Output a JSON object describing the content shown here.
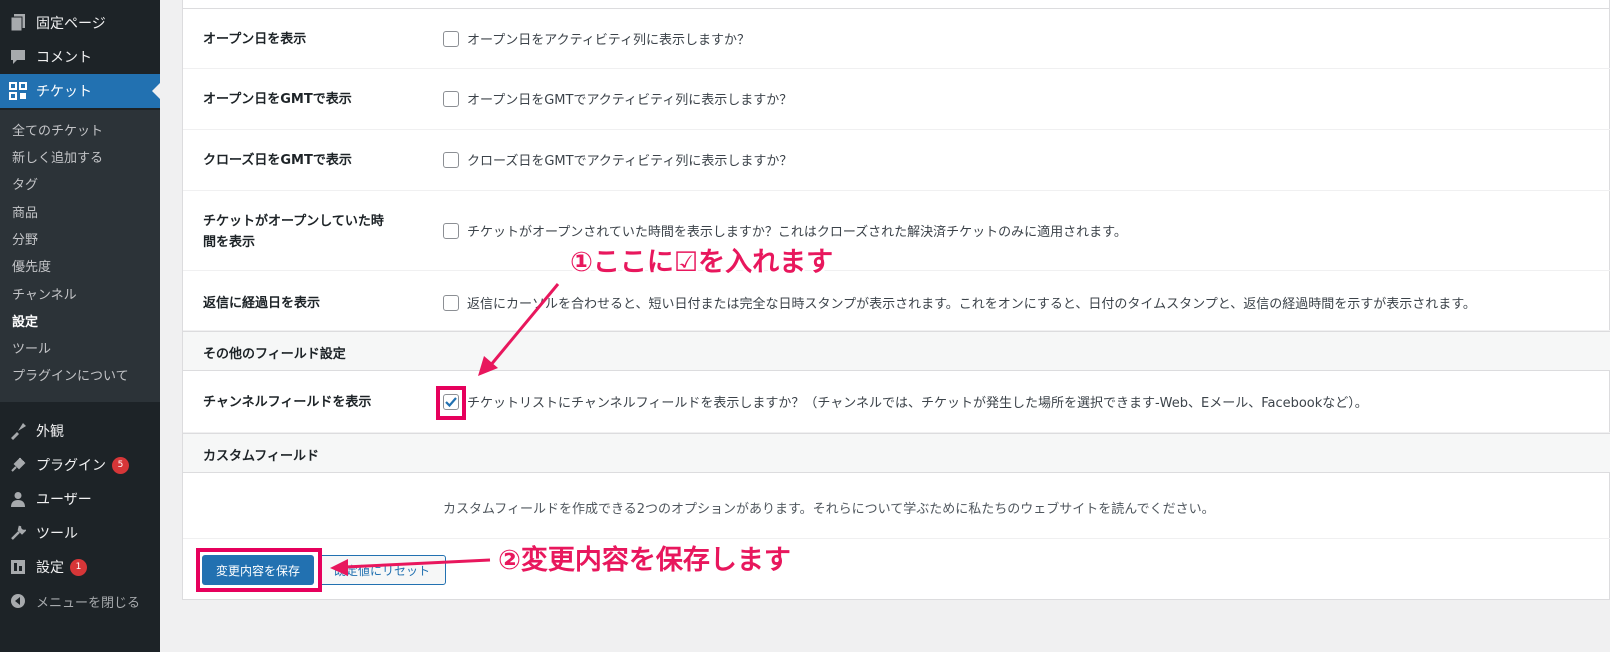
{
  "sidebar": {
    "menu": [
      {
        "label": "固定ページ",
        "icon": "pages-icon"
      },
      {
        "label": "コメント",
        "icon": "comment-icon"
      },
      {
        "label": "チケット",
        "icon": "ticket-icon"
      }
    ],
    "submenu": [
      "全てのチケット",
      "新しく追加する",
      "タグ",
      "商品",
      "分野",
      "優先度",
      "チャンネル",
      "設定",
      "ツール",
      "プラグインについて"
    ],
    "menu2": [
      {
        "label": "外観",
        "icon": "appearance-icon"
      },
      {
        "label": "プラグイン",
        "icon": "plugin-icon",
        "badge": "5"
      },
      {
        "label": "ユーザー",
        "icon": "user-icon"
      },
      {
        "label": "ツール",
        "icon": "wrench-icon"
      },
      {
        "label": "設定",
        "icon": "settings-icon",
        "badge": "1"
      }
    ],
    "collapse": "メニューを閉じる"
  },
  "settings": {
    "rows": [
      {
        "label": "オープン日を表示",
        "text": "オープン日をアクティビティ列に表示しますか？"
      },
      {
        "label": "オープン日をGMTで表示",
        "text": "オープン日をGMTでアクティビティ列に表示しますか？"
      },
      {
        "label": "クローズ日をGMTで表示",
        "text": "クローズ日をGMTでアクティビティ列に表示しますか？"
      },
      {
        "label_line1": "チケットがオープンしていた時",
        "label_line2": "間を表示",
        "text": "チケットがオープンされていた時間を表示しますか？これはクローズされた解決済チケットのみに適用されます。"
      },
      {
        "label": "返信に経過日を表示",
        "text": "返信にカーソルを合わせると、短い日付または完全な日時スタンプが表示されます。これをオンにすると、日付のタイムスタンプと、返信の経過時間を示すが表示されます。"
      }
    ],
    "other_section": "その他のフィールド設定",
    "channel_row": {
      "label": "チャンネルフィールドを表示",
      "text": "チケットリストにチャンネルフィールドを表示しますか？（チャンネルでは、チケットが発生した場所を選択できます-Web、Eメール、Facebookなど）。",
      "checked": true
    },
    "custom_section": "カスタムフィールド",
    "custom_desc": "カスタムフィールドを作成できる2つのオプションがあります。それらについて学ぶために私たちのウェブサイトを読んでください。",
    "save_label": "変更内容を保存",
    "reset_label": "既定値にリセット"
  },
  "annotations": {
    "step1": "①ここに☑を入れます",
    "step2": "②変更内容を保存します",
    "color": "#e8175d"
  }
}
